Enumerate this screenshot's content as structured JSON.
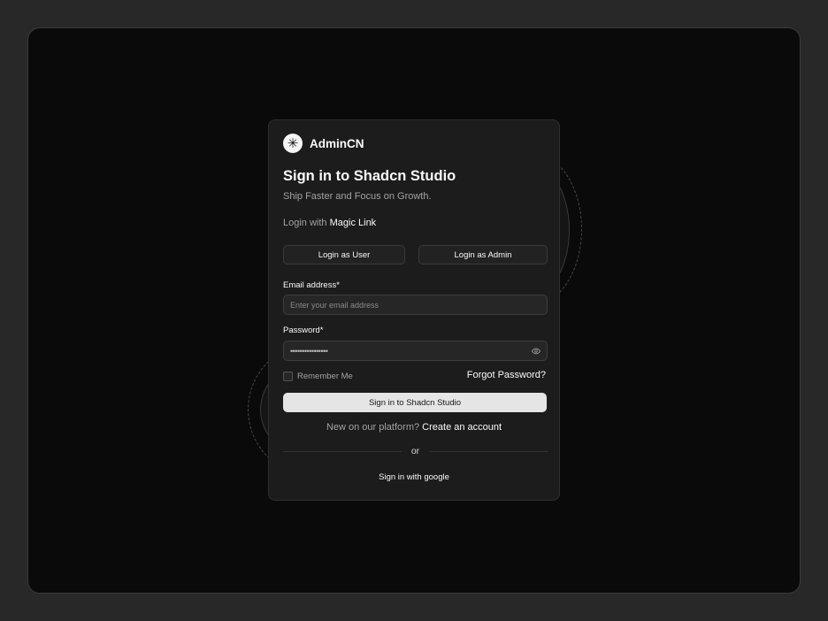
{
  "brand": {
    "name": "AdminCN",
    "logo_glyph": "✳"
  },
  "heading": {
    "title": "Sign in to Shadcn Studio",
    "subtitle": "Ship Faster and Focus on Growth."
  },
  "magic": {
    "prefix": "Login with",
    "link": "Magic Link"
  },
  "quick_login": {
    "user": "Login as User",
    "admin": "Login as Admin"
  },
  "email": {
    "label": "Email address*",
    "placeholder": "Enter your email address"
  },
  "password": {
    "label": "Password*",
    "value": "••••••••••••••••"
  },
  "remember": {
    "label": "Remember Me",
    "checked": false
  },
  "forgot": "Forgot Password?",
  "submit": "Sign in to Shadcn Studio",
  "signup": {
    "prefix": "New on our platform?",
    "link": "Create an account"
  },
  "divider": "or",
  "google": "Sign in with google",
  "colors": {
    "background": "#0a0a0a",
    "card": "#1c1c1c",
    "primary_button": "#e5e5e5"
  }
}
